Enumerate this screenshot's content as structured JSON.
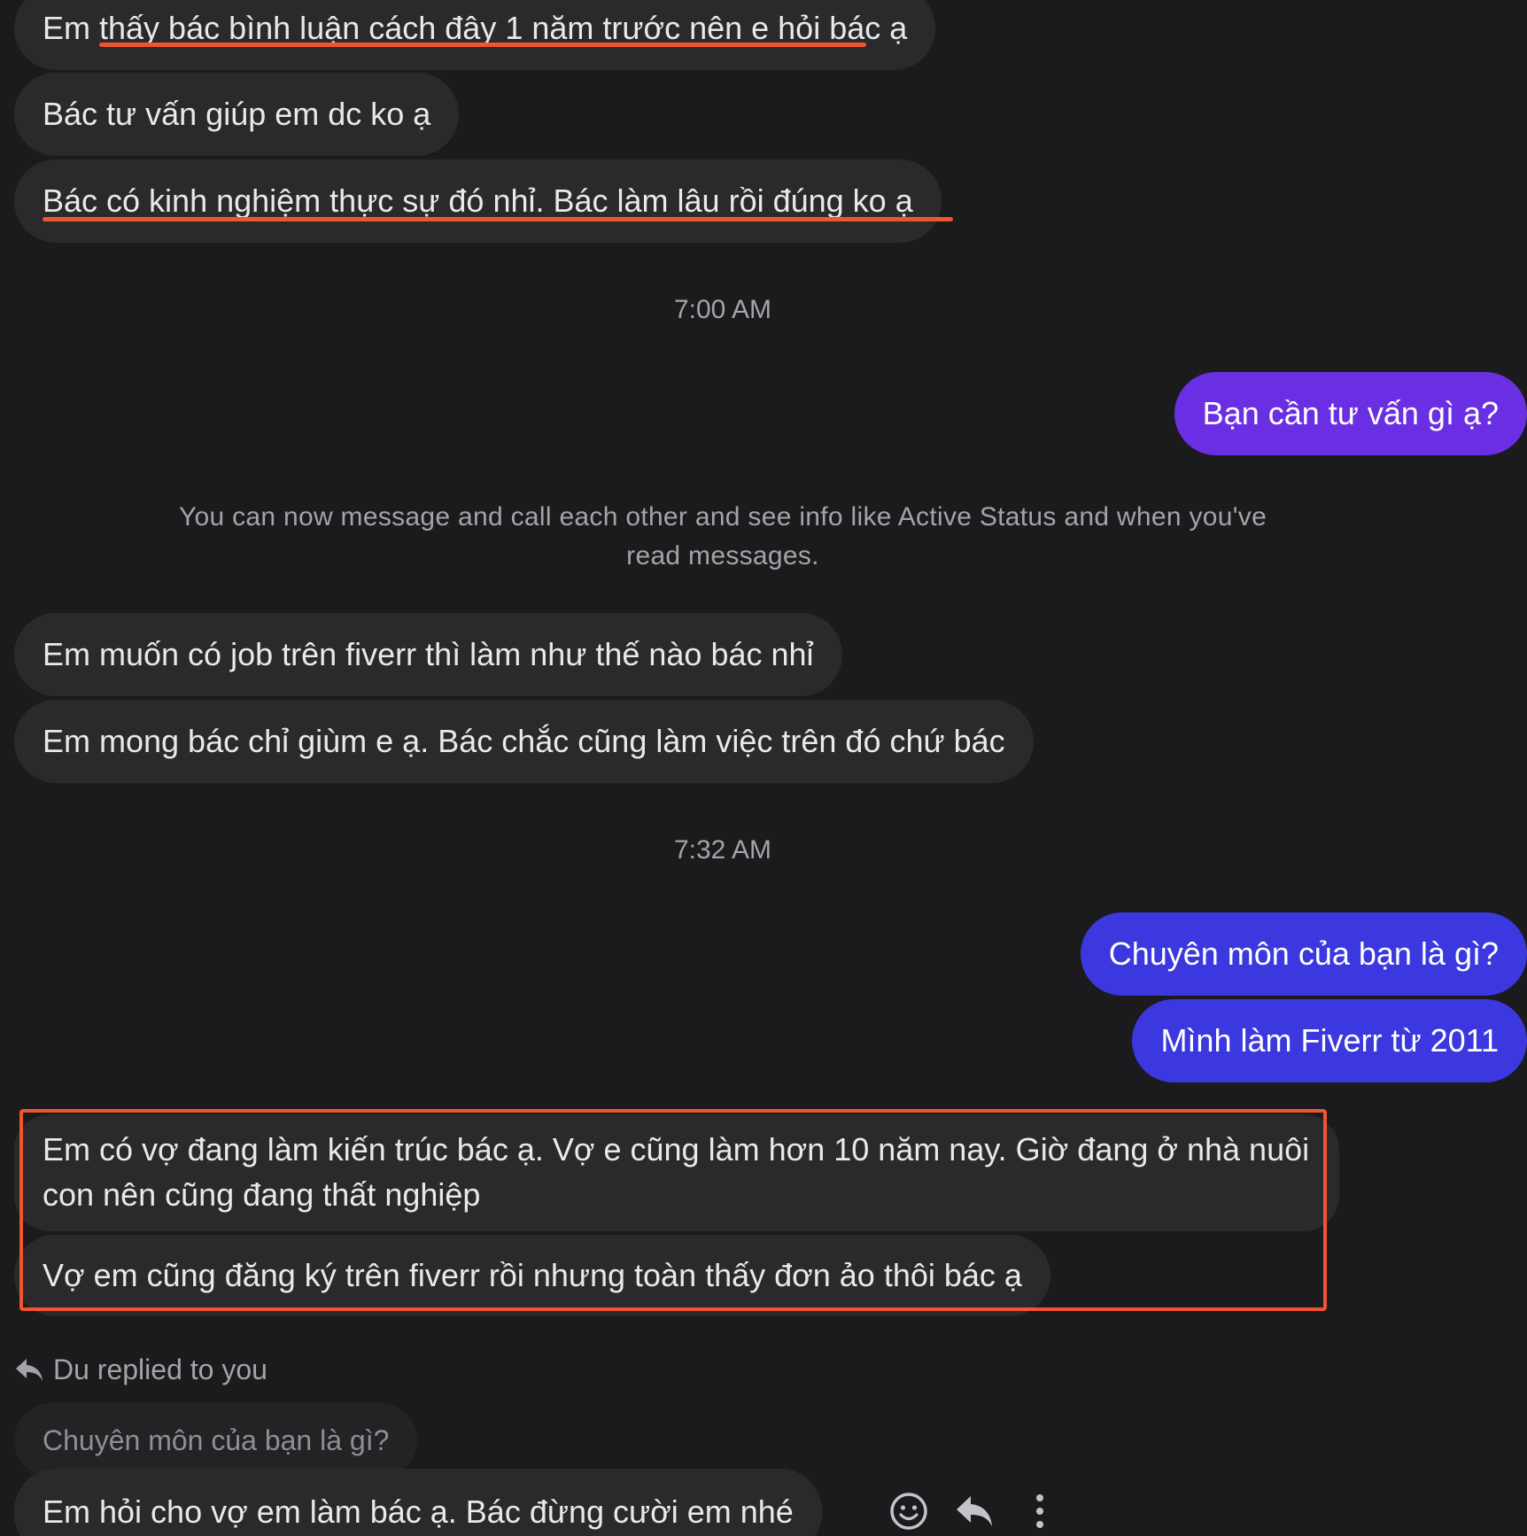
{
  "messages": {
    "m1": "Em thấy bác bình luận cách đây 1 năm trước nên e hỏi bác ạ",
    "m2": "Bác tư vấn giúp em dc ko ạ",
    "m3": "Bác có kinh nghiệm thực sự đó nhỉ. Bác làm lâu rồi đúng ko ạ",
    "time1": "7:00 AM",
    "out1": "Bạn cần tư vấn gì ạ?",
    "notice": "You can now message and call each other and see info like Active Status and when you've read messages.",
    "m4": "Em muốn có job trên fiverr thì làm như thế nào bác nhỉ",
    "m5": "Em mong bác chỉ giùm e ạ. Bác chắc cũng làm việc trên đó chứ bác",
    "time2": "7:32 AM",
    "out2": "Chuyên môn của bạn là gì?",
    "out3": "Mình làm Fiverr từ 2011",
    "m6": "Em có vợ đang làm kiến trúc bác ạ. Vợ e cũng làm hơn 10 năm nay. Giờ đang ở nhà nuôi con nên cũng đang thất nghiệp",
    "m7": "Vợ em cũng đăng ký trên fiverr rồi nhưng toàn thấy đơn ảo thôi bác ạ",
    "reply_header": "Du replied to you",
    "quoted": "Chuyên môn của bạn là gì?",
    "m8": "Em hỏi cho vợ em làm bác ạ. Bác đừng cười em nhé"
  },
  "icons": {
    "react": "smiley-icon",
    "reply": "reply-arrow-icon",
    "more": "more-vertical-icon"
  },
  "colors": {
    "background": "#1b1b1d",
    "incoming_bubble": "#2a2a2d",
    "outgoing_purple": "#6a2fe3",
    "outgoing_blue": "#3b38df",
    "annotation": "#ee5530"
  }
}
